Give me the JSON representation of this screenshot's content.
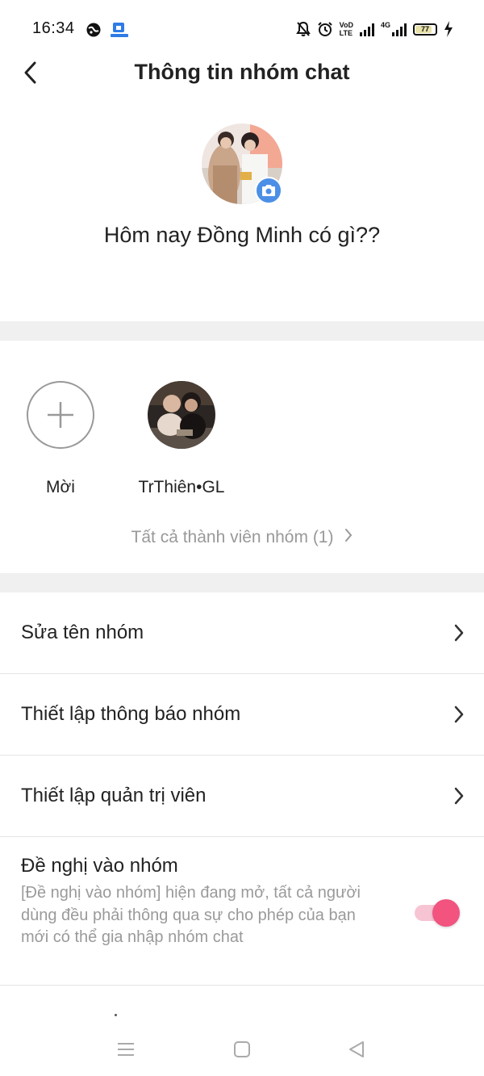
{
  "status_bar": {
    "time": "16:34",
    "network_label_top": "VoD",
    "network_label_bottom": "LTE",
    "data_label": "4G",
    "battery": "77",
    "battery_fraction": 0.77
  },
  "header": {
    "title": "Thông tin nhóm chat"
  },
  "group": {
    "name": "Hôm nay Đồng Minh có gì??"
  },
  "members": {
    "invite_label": "Mời",
    "list": [
      {
        "name": "TrThiên•GL"
      }
    ],
    "all_members_label": "Tất cả thành viên nhóm (1)"
  },
  "settings": {
    "rows": [
      {
        "label": "Sửa tên nhóm"
      },
      {
        "label": "Thiết lập thông báo nhóm"
      },
      {
        "label": "Thiết lập quản trị viên"
      }
    ],
    "join_request": {
      "title": "Đề nghị vào nhóm",
      "description": "[Đề nghị vào nhóm] hiện đang mở, tất cả người dùng đều phải thông qua sự cho phép của bạn mới có thể gia nhập nhóm chat",
      "enabled": true
    }
  },
  "colors": {
    "accent_pink": "#f2537f",
    "camera_blue": "#4c8fe6",
    "muted_text": "#9a9a9a",
    "divider": "#f0f0f0"
  },
  "icons": {
    "back": "chevron-left-icon",
    "camera": "camera-icon",
    "invite": "plus-icon",
    "row": "chevron-right-icon",
    "nav": [
      "menu-icon",
      "home-square-icon",
      "back-triangle-icon"
    ]
  }
}
